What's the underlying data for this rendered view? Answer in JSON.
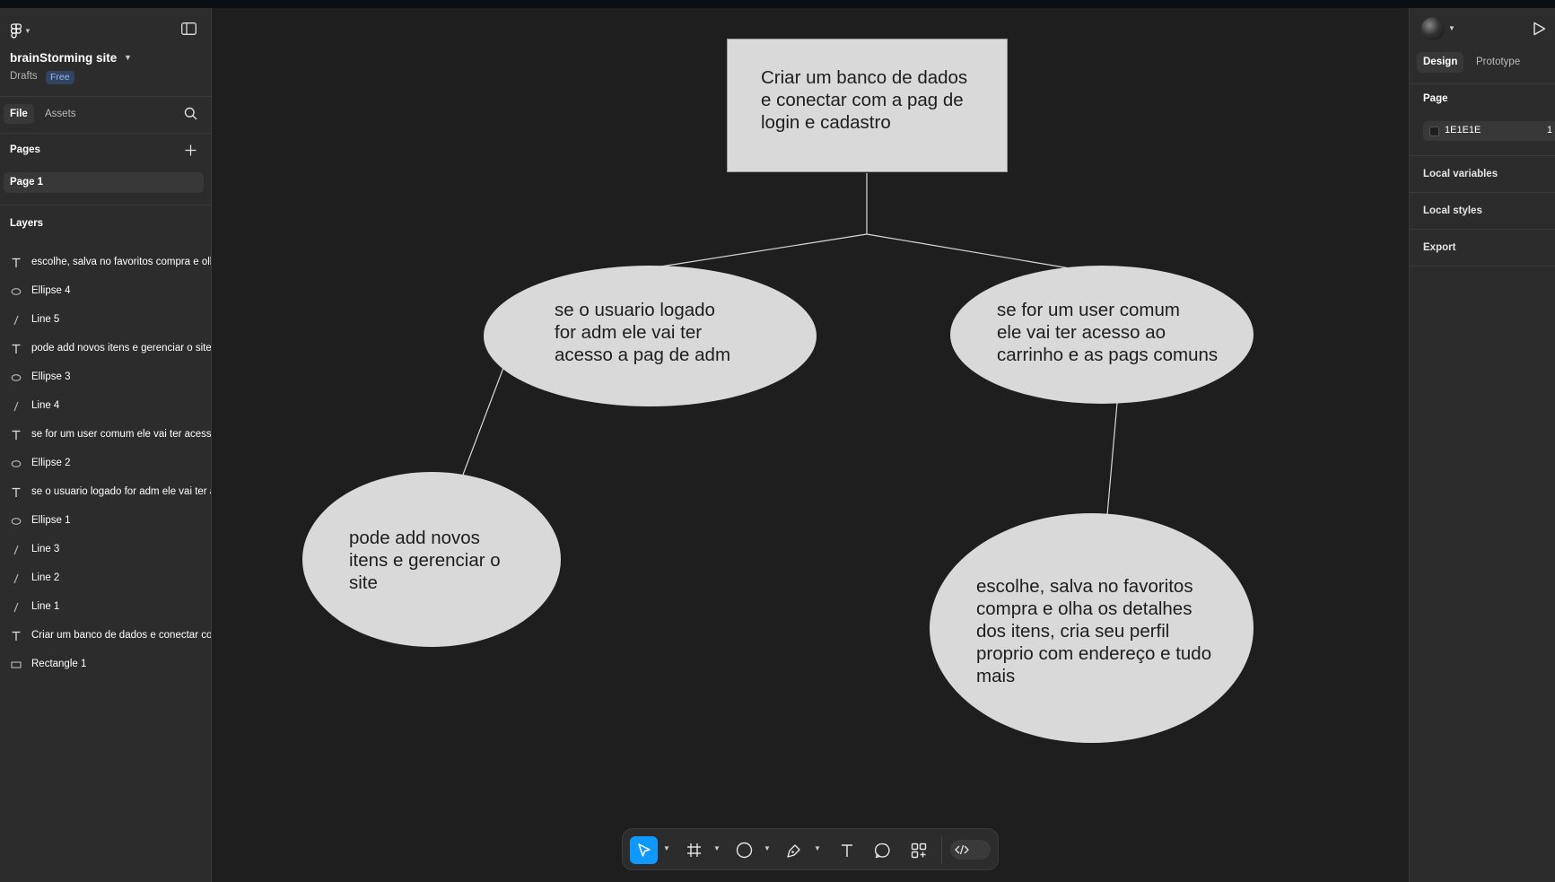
{
  "file": {
    "title": "brainStorming site",
    "location": "Drafts",
    "plan_badge": "Free"
  },
  "left_panel": {
    "tabs": {
      "file": "File",
      "assets": "Assets"
    },
    "pages_header": "Pages",
    "pages": [
      {
        "label": "Page 1",
        "selected": true
      }
    ],
    "layers_header": "Layers",
    "layers": [
      {
        "type": "text",
        "icon": "text-layer-icon",
        "label": "escolhe, salva no favoritos compra e olha os detalhes dos itens, cria seu perfil proprio com endereço e tudo mais"
      },
      {
        "type": "ellipse",
        "icon": "ellipse-layer-icon",
        "label": "Ellipse 4"
      },
      {
        "type": "line",
        "icon": "line-layer-icon",
        "label": "Line 5"
      },
      {
        "type": "text",
        "icon": "text-layer-icon",
        "label": "pode add novos itens e gerenciar o site"
      },
      {
        "type": "ellipse",
        "icon": "ellipse-layer-icon",
        "label": "Ellipse 3"
      },
      {
        "type": "line",
        "icon": "line-layer-icon",
        "label": "Line 4"
      },
      {
        "type": "text",
        "icon": "text-layer-icon",
        "label": "se for um user comum ele vai ter acesso ao carrinho e as pags comuns"
      },
      {
        "type": "ellipse",
        "icon": "ellipse-layer-icon",
        "label": "Ellipse 2"
      },
      {
        "type": "text",
        "icon": "text-layer-icon",
        "label": "se o usuario logado for adm ele vai ter acesso a pag de adm"
      },
      {
        "type": "ellipse",
        "icon": "ellipse-layer-icon",
        "label": "Ellipse 1"
      },
      {
        "type": "line",
        "icon": "line-layer-icon",
        "label": "Line 3"
      },
      {
        "type": "line",
        "icon": "line-layer-icon",
        "label": "Line 2"
      },
      {
        "type": "line",
        "icon": "line-layer-icon",
        "label": "Line 1"
      },
      {
        "type": "text",
        "icon": "text-layer-icon",
        "label": "Criar um banco de dados e conectar com a pag de login e cadastro"
      },
      {
        "type": "rectangle",
        "icon": "rectangle-layer-icon",
        "label": "Rectangle 1"
      }
    ]
  },
  "canvas": {
    "nodes": {
      "root": {
        "lines": [
          "Criar um banco de dados",
          "e conectar com a pag de",
          "login e cadastro"
        ]
      },
      "adm": {
        "lines": [
          "se o usuario logado",
          "for adm ele vai ter",
          "acesso a pag de adm"
        ]
      },
      "user": {
        "lines": [
          "se for um user comum",
          "ele vai ter acesso ao",
          "carrinho e as pags comuns"
        ]
      },
      "adm_child": {
        "lines": [
          "pode add novos",
          "itens e gerenciar o",
          "site"
        ]
      },
      "user_child": {
        "lines": [
          "escolhe, salva no favoritos",
          "compra e olha os detalhes",
          "dos itens, cria seu perfil",
          "proprio com endereço e tudo",
          "mais"
        ]
      }
    },
    "colors": {
      "background": "#1e1e1e",
      "shape_fill": "#d9d9d9",
      "connector": "#d9d9d9"
    }
  },
  "toolbar": {
    "tools": [
      "move-tool",
      "frame-tool",
      "shape-tool",
      "pen-tool",
      "text-tool",
      "comment-tool",
      "actions-tool",
      "dev-mode-toggle"
    ],
    "active": "move-tool",
    "accent": "#0d99ff"
  },
  "right_panel": {
    "tabs": {
      "design": "Design",
      "prototype": "Prototype"
    },
    "page_section": "Page",
    "page_color_hex": "1E1E1E",
    "page_opacity": "1",
    "sections": [
      "Local variables",
      "Local styles",
      "Export"
    ]
  }
}
